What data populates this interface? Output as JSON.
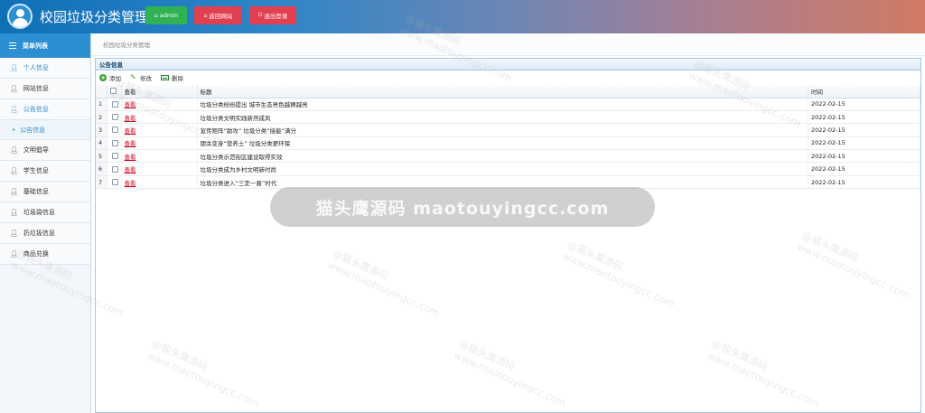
{
  "header": {
    "title": "校园垃圾分类管理",
    "user_label": "admin",
    "back_label": "返回网站",
    "logout_label": "退出登录"
  },
  "sidebar": {
    "menu_title": "菜单列表",
    "items": [
      {
        "label": "个人信息",
        "icon": "user-icon"
      },
      {
        "label": "网站信息",
        "icon": "user-icon"
      },
      {
        "label": "公告信息",
        "icon": "user-icon"
      },
      {
        "label": "文明倡导",
        "icon": "user-icon"
      },
      {
        "label": "学生信息",
        "icon": "user-icon"
      },
      {
        "label": "基础信息",
        "icon": "user-icon"
      },
      {
        "label": "垃圾袋信息",
        "icon": "user-icon"
      },
      {
        "label": "扔垃圾信息",
        "icon": "user-icon"
      },
      {
        "label": "商品兑换",
        "icon": "user-icon"
      }
    ],
    "sub_item": "公告信息"
  },
  "breadcrumb": "校园垃圾分类管理",
  "panel": {
    "title": "公告信息",
    "toolbar": {
      "add": "添加",
      "edit": "修改",
      "delete": "删除"
    },
    "columns": {
      "view": "查看",
      "title": "标题",
      "time": "时间"
    },
    "rows": [
      {
        "no": "1",
        "view": "查看",
        "title": "垃圾分类纷纷提出 城市生态亮色越擦越亮",
        "time": "2022-02-15"
      },
      {
        "no": "2",
        "view": "查看",
        "title": "垃圾分类文明实践新然成风",
        "time": "2022-02-15"
      },
      {
        "no": "3",
        "view": "查看",
        "title": "宣传矩阵“助攻” 垃圾分类“接能”满分",
        "time": "2022-02-15"
      },
      {
        "no": "4",
        "view": "查看",
        "title": "朋余变身“营养土” 垃圾分类更环保",
        "time": "2022-02-15"
      },
      {
        "no": "5",
        "view": "查看",
        "title": "垃圾分类示范街区建设取得实效",
        "time": "2022-02-15"
      },
      {
        "no": "6",
        "view": "查看",
        "title": "垃圾分类成为乡村文明新时尚",
        "time": "2022-02-15"
      },
      {
        "no": "7",
        "view": "查看",
        "title": "垃圾分类进入“三定一督”时代",
        "time": "2022-02-15"
      }
    ]
  },
  "watermark": {
    "banner": "猫头鹰源码 maotouyingcc.com",
    "text_cn": "@猫头鹰源码",
    "text_en": "www.maotouyingcc.com"
  }
}
